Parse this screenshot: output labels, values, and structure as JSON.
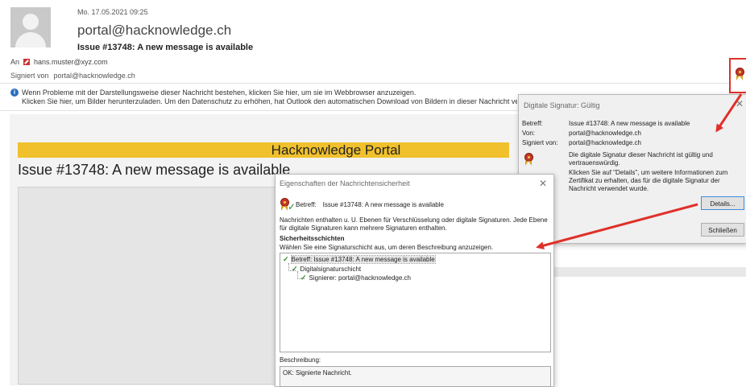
{
  "email": {
    "date": "Mo. 17.05.2021 09:25",
    "from": "portal@hacknowledge.ch",
    "subject": "Issue #13748: A new message is available",
    "to_label": "An",
    "to_address": "hans.muster@xyz.com",
    "signed_label": "Signiert von",
    "signed_by": "portal@hacknowledge.ch",
    "info_line1": "Wenn Probleme mit der Darstellungsweise dieser Nachricht bestehen, klicken Sie hier, um sie im Webbrowser anzuzeigen.",
    "info_line2": "Klicken Sie hier, um Bilder herunterzuladen. Um den Datenschutz zu erhöhen, hat Outlook den automatischen Download von Bildern in dieser Nachricht verhindert."
  },
  "body": {
    "portal_title": "Hacknowledge Portal",
    "issue_title": "Issue #13748: A new message is available"
  },
  "signature_dialog": {
    "title": "Digitale Signatur: Gültig",
    "betreff_label": "Betreff:",
    "betreff_value": "Issue #13748: A new message is available",
    "von_label": "Von:",
    "von_value": "portal@hacknowledge.ch",
    "signiert_label": "Signiert von:",
    "signiert_value": "portal@hacknowledge.ch",
    "status_text": "Die digitale Signatur dieser Nachricht ist gültig und vertrauenswürdig.",
    "details_hint": "Klicken Sie auf \"Details\", um weitere Informationen zum Zertifikat zu erhalten, das für die digitale Signatur der Nachricht verwendet wurde.",
    "details_button": "Details...",
    "close_button": "Schließen"
  },
  "properties_dialog": {
    "title": "Eigenschaften der Nachrichtensicherheit",
    "betreff_label": "Betreff:",
    "betreff_value": "Issue #13748: A new message is available",
    "description": "Nachrichten enthalten u. U. Ebenen für Verschlüsselung oder digitale Signaturen. Jede Ebene für digitale Signaturen kann mehrere Signaturen enthalten.",
    "layers_heading": "Sicherheitsschichten",
    "layers_hint": "Wählen Sie eine Signaturschicht aus, um deren Beschreibung anzuzeigen.",
    "tree": [
      "Betreff: Issue #13748: A new message is available",
      "Digitalsignaturschicht",
      "Signierer: portal@hacknowledge.ch"
    ],
    "desc_label": "Beschreibung:",
    "desc_value": "OK: Signierte Nachricht."
  },
  "icons": {
    "avatar": "user-avatar-icon",
    "info": "info-icon",
    "signature": "award-ribbon-icon",
    "check": "checkmark-icon",
    "close": "close-icon"
  },
  "colors": {
    "portal_bar": "#f0c12d",
    "highlight": "#e0302a",
    "check": "#2d8a2d",
    "info": "#2a6ebd"
  }
}
